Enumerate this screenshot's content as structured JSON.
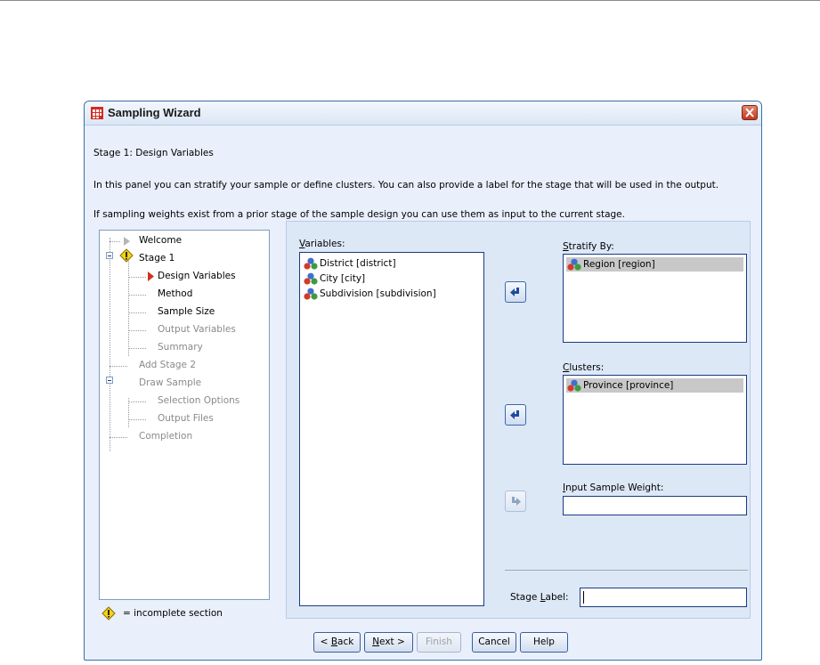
{
  "window": {
    "title": "Sampling Wizard"
  },
  "header": {
    "stage_heading": "Stage 1: Design Variables",
    "description": "In this panel you can stratify your sample or define clusters. You can also provide a label for the stage that will be used in the output.",
    "note": "If sampling weights exist from a prior stage of the sample design you can use them as input to the current stage."
  },
  "nav": {
    "items": [
      {
        "label": "Welcome",
        "state": "done"
      },
      {
        "label": "Stage 1",
        "state": "incomplete"
      },
      {
        "label": "Design Variables",
        "state": "current"
      },
      {
        "label": "Method",
        "state": "enabled"
      },
      {
        "label": "Sample Size",
        "state": "enabled"
      },
      {
        "label": "Output Variables",
        "state": "disabled"
      },
      {
        "label": "Summary",
        "state": "disabled"
      },
      {
        "label": "Add Stage 2",
        "state": "disabled"
      },
      {
        "label": "Draw Sample",
        "state": "disabled"
      },
      {
        "label": "Selection Options",
        "state": "disabled"
      },
      {
        "label": "Output Files",
        "state": "disabled"
      },
      {
        "label": "Completion",
        "state": "disabled"
      }
    ],
    "legend": "= incomplete section"
  },
  "variables": {
    "label": "Variables:",
    "mnemonic": "V",
    "items": [
      {
        "label": "District [district]",
        "icon": "nominal-measure-icon"
      },
      {
        "label": "City [city]",
        "icon": "nominal-measure-icon"
      },
      {
        "label": "Subdivision [subdivision]",
        "icon": "nominal-measure-icon"
      }
    ]
  },
  "stratify": {
    "label": "Stratify By:",
    "mnemonic": "S",
    "items": [
      {
        "label": "Region [region]",
        "icon": "nominal-measure-icon"
      }
    ]
  },
  "clusters": {
    "label": "Clusters:",
    "mnemonic": "C",
    "items": [
      {
        "label": "Province [province]",
        "icon": "nominal-measure-icon"
      }
    ]
  },
  "weight": {
    "label": "Input Sample Weight:",
    "mnemonic": "I",
    "value": ""
  },
  "stage_label": {
    "label": "Stage Label:",
    "mnemonic": "L",
    "value": ""
  },
  "buttons": {
    "back": "< Back",
    "next": "Next >",
    "finish": "Finish",
    "cancel": "Cancel",
    "help": "Help"
  },
  "colors": {
    "accent": "#1b3a82",
    "selection": "#c8c8c8",
    "panel_bg": "#e9f0fb",
    "current_arrow": "#d0321e",
    "warning": "#f2d21c"
  }
}
